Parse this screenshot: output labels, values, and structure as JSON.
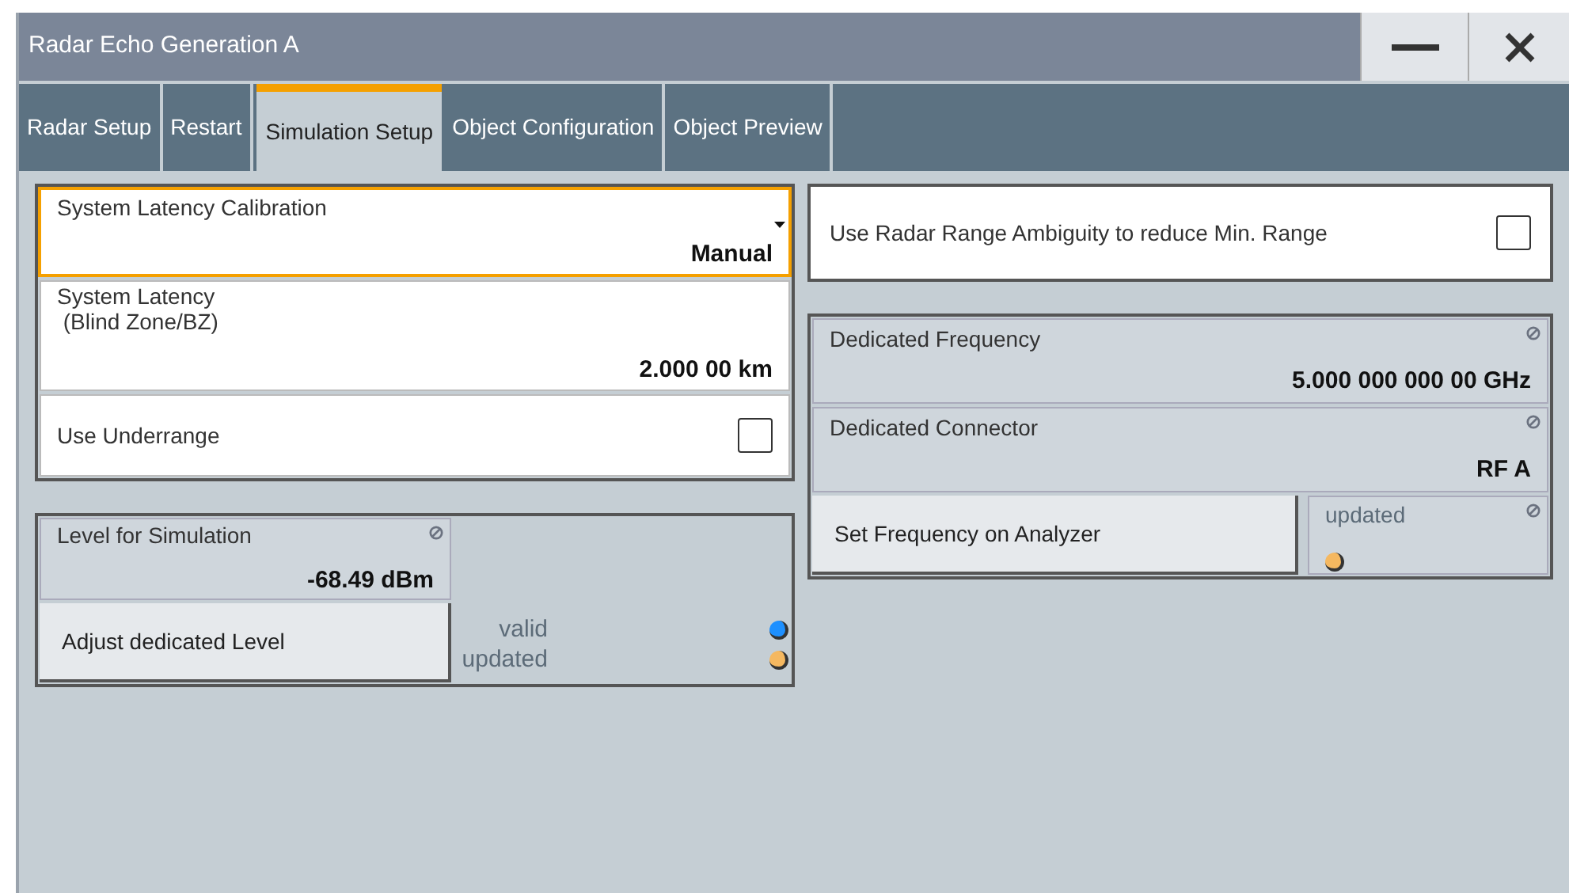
{
  "window": {
    "title": "Radar Echo Generation A"
  },
  "tabs": [
    {
      "label": "Radar Setup",
      "selected": false
    },
    {
      "label": "Restart",
      "selected": false
    },
    {
      "label": "Simulation Setup",
      "selected": true
    },
    {
      "label": "Object Configuration",
      "selected": false
    },
    {
      "label": "Object Preview",
      "selected": false
    }
  ],
  "calibration": {
    "label": "System Latency Calibration",
    "value": "Manual"
  },
  "latency": {
    "label_lines": [
      "System Latency",
      "(Blind Zone/BZ)"
    ],
    "value": "2.000 00 km"
  },
  "underrange": {
    "label": "Use Underrange",
    "checked": false
  },
  "level_group": {
    "label": "Level for Simulation",
    "value": "-68.49 dBm",
    "button": "Adjust dedicated Level",
    "indicators": [
      {
        "label": "valid",
        "color": "#1e90ff"
      },
      {
        "label": "updated",
        "color": "#f5b860"
      }
    ]
  },
  "ambiguity": {
    "label": "Use Radar Range Ambiguity to reduce Min. Range",
    "checked": false
  },
  "frequency": {
    "label": "Dedicated Frequency",
    "value": "5.000 000 000 00 GHz"
  },
  "connector": {
    "label": "Dedicated Connector",
    "value": "RF A"
  },
  "analyzer": {
    "button": "Set Frequency on Analyzer",
    "status": {
      "label": "updated",
      "color": "#f5b860"
    }
  }
}
